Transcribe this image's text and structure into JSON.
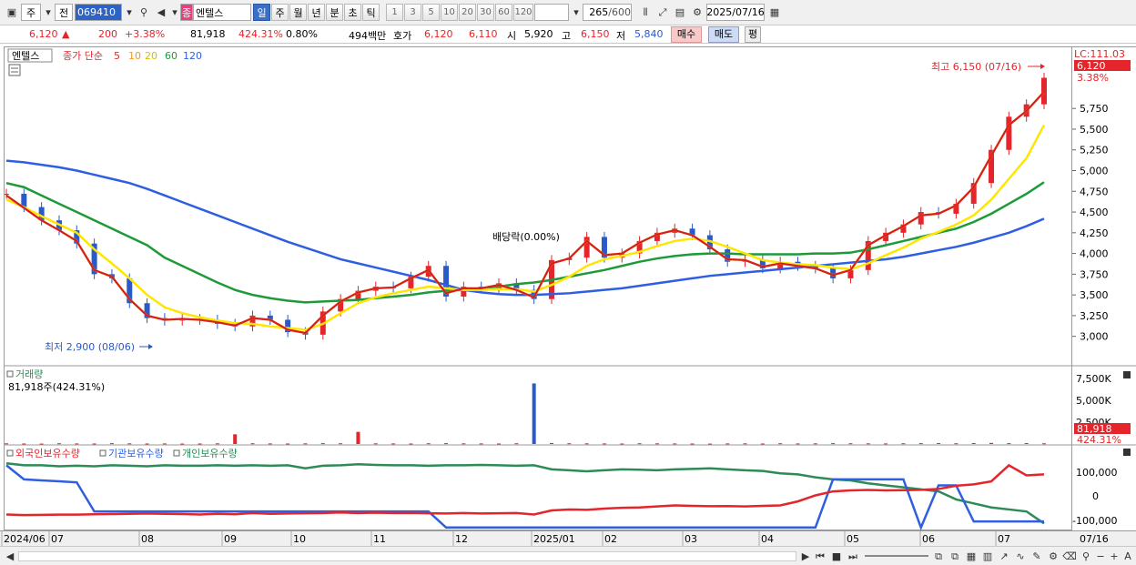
{
  "toolbar": {
    "market": "주",
    "prefix": "전",
    "code": "069410",
    "name_badge": "종",
    "stock_name": "엔텔스",
    "periods": [
      "일",
      "주",
      "월",
      "년",
      "분",
      "초",
      "틱"
    ],
    "selected_period": "일",
    "numbers": [
      "1",
      "3",
      "5",
      "10",
      "20",
      "30",
      "60",
      "120"
    ],
    "count": "265",
    "count_max": "/600",
    "date": "2025/07/16"
  },
  "quote": {
    "price": "6,120",
    "arrow": "▲",
    "change": "200",
    "change_pct": "+3.38%",
    "volume": "81,918",
    "volume_ratio": "424.31%",
    "turnover": "0.80%",
    "amount": "494백만",
    "ask_label": "호가",
    "ask": "6,120",
    "bid": "6,110",
    "open_label": "시",
    "open": "5,920",
    "high_label": "고",
    "high": "6,150",
    "low_label": "저",
    "low": "5,840",
    "buy_button": "매수",
    "sell_button": "매도",
    "eval_button": "평"
  },
  "legend": {
    "name": "엔텔스",
    "ma_label": "종가 단순",
    "ma_periods": [
      "5",
      "10",
      "20",
      "60",
      "120"
    ],
    "ma_colors": [
      "#e4252b",
      "#f29a1e",
      "#ffe600",
      "#1f9a3a",
      "#2f5fe0"
    ]
  },
  "annotations": {
    "high": "최고 6,150 (07/16)",
    "low": "최저 2,900 (08/06)",
    "dividend": "배당락(0.00%)",
    "lc": "LC:111.03",
    "last_price": "6,120",
    "last_pct": "3.38%"
  },
  "volume_panel": {
    "title": "거래량",
    "value": "81,918주(424.31%)",
    "last": "81,918",
    "last_pct": "424.31%",
    "ticks": [
      "7,500K",
      "5,000K",
      "2,500K"
    ]
  },
  "holdings_panel": {
    "series": [
      "외국인보유수량",
      "기관보유수량",
      "개인보유수량"
    ],
    "colors": [
      "#e4252b",
      "#2f5fe0",
      "#2e8b57"
    ],
    "ticks": [
      "100,000",
      "0",
      "-100,000"
    ]
  },
  "price_ticks": [
    "5,750",
    "5,500",
    "5,250",
    "5,000",
    "4,750",
    "4,500",
    "4,250",
    "4,000",
    "3,750",
    "3,500",
    "3,250",
    "3,000"
  ],
  "x_labels": [
    "2024/06",
    "07",
    "08",
    "09",
    "10",
    "11",
    "12",
    "2025/01",
    "02",
    "03",
    "04",
    "05",
    "06",
    "07"
  ],
  "x_last": "07/16",
  "chart_data": {
    "type": "line",
    "title": "",
    "y_range": [
      2700,
      6400
    ],
    "x_range": [
      "2024/06",
      "2025/07/16"
    ],
    "price_close": [
      4720,
      4560,
      4400,
      4280,
      4120,
      3750,
      3700,
      3400,
      3220,
      3190,
      3210,
      3200,
      3150,
      3120,
      3250,
      3200,
      3050,
      3020,
      3300,
      3450,
      3550,
      3600,
      3580,
      3720,
      3850,
      3480,
      3600,
      3580,
      3640,
      3560,
      3450,
      3920,
      3950,
      4200,
      3950,
      4000,
      4150,
      4250,
      4300,
      4220,
      4050,
      3900,
      3920,
      3820,
      3900,
      3850,
      3820,
      3700,
      3800,
      4150,
      4250,
      4350,
      4500,
      4480,
      4600,
      4850,
      5250,
      5650,
      5800,
      6120
    ],
    "sma5": [
      4700,
      4550,
      4400,
      4280,
      4150,
      3800,
      3720,
      3450,
      3250,
      3200,
      3210,
      3200,
      3170,
      3130,
      3220,
      3200,
      3080,
      3040,
      3250,
      3420,
      3530,
      3580,
      3590,
      3700,
      3800,
      3520,
      3580,
      3580,
      3620,
      3560,
      3470,
      3880,
      3940,
      4150,
      3980,
      4000,
      4130,
      4230,
      4280,
      4220,
      4080,
      3930,
      3920,
      3840,
      3880,
      3850,
      3820,
      3740,
      3800,
      4100,
      4220,
      4330,
      4460,
      4480,
      4580,
      4800,
      5180,
      5550,
      5720,
      5950
    ],
    "sma20": [
      4650,
      4560,
      4450,
      4350,
      4250,
      4050,
      3880,
      3700,
      3500,
      3350,
      3280,
      3230,
      3190,
      3160,
      3150,
      3120,
      3100,
      3080,
      3150,
      3280,
      3400,
      3470,
      3520,
      3560,
      3600,
      3580,
      3560,
      3560,
      3570,
      3570,
      3540,
      3620,
      3720,
      3850,
      3930,
      3970,
      4020,
      4090,
      4150,
      4180,
      4150,
      4080,
      4000,
      3920,
      3890,
      3870,
      3860,
      3830,
      3810,
      3880,
      3980,
      4070,
      4180,
      4260,
      4350,
      4460,
      4650,
      4900,
      5150,
      5550
    ],
    "sma60": [
      4850,
      4800,
      4700,
      4600,
      4500,
      4400,
      4300,
      4200,
      4100,
      3950,
      3850,
      3750,
      3650,
      3560,
      3500,
      3460,
      3430,
      3410,
      3420,
      3430,
      3440,
      3460,
      3480,
      3500,
      3530,
      3550,
      3560,
      3580,
      3600,
      3630,
      3650,
      3680,
      3720,
      3760,
      3800,
      3850,
      3900,
      3940,
      3970,
      3990,
      4000,
      4000,
      3990,
      3990,
      3990,
      3990,
      4000,
      4000,
      4010,
      4050,
      4100,
      4150,
      4200,
      4250,
      4300,
      4380,
      4480,
      4600,
      4720,
      4860
    ],
    "sma120": [
      5120,
      5100,
      5070,
      5040,
      5000,
      4950,
      4900,
      4850,
      4780,
      4700,
      4620,
      4540,
      4460,
      4380,
      4300,
      4220,
      4140,
      4070,
      4000,
      3930,
      3880,
      3830,
      3780,
      3730,
      3680,
      3620,
      3560,
      3530,
      3510,
      3500,
      3500,
      3510,
      3520,
      3540,
      3560,
      3580,
      3610,
      3640,
      3670,
      3700,
      3730,
      3750,
      3770,
      3790,
      3810,
      3830,
      3850,
      3870,
      3890,
      3910,
      3930,
      3960,
      4000,
      4040,
      4080,
      4130,
      4190,
      4250,
      4330,
      4420
    ],
    "volume": [
      80,
      60,
      50,
      90,
      70,
      60,
      100,
      80,
      60,
      70,
      50,
      60,
      80,
      1200,
      90,
      70,
      60,
      80,
      100,
      90,
      1500,
      80,
      70,
      60,
      90,
      100,
      80,
      70,
      60,
      90,
      7500,
      120,
      90,
      80,
      70,
      60,
      90,
      80,
      70,
      60,
      50,
      70,
      80,
      60,
      90,
      70,
      80,
      100,
      90,
      80,
      70,
      90,
      100,
      110,
      90,
      120,
      130,
      100,
      110,
      82
    ],
    "foreign": [
      -95000,
      -98000,
      -97000,
      -96000,
      -96000,
      -94000,
      -93000,
      -92000,
      -90000,
      -92000,
      -93000,
      -95000,
      -92000,
      -94000,
      -88000,
      -92000,
      -90000,
      -89000,
      -88000,
      -85000,
      -88000,
      -86000,
      -88000,
      -87000,
      -89000,
      -90000,
      -88000,
      -90000,
      -89000,
      -88000,
      -95000,
      -75000,
      -70000,
      -72000,
      -66000,
      -62000,
      -60000,
      -55000,
      -50000,
      -52000,
      -54000,
      -53000,
      -55000,
      -52000,
      -50000,
      -30000,
      0,
      20000,
      25000,
      27000,
      25000,
      26000,
      28000,
      32000,
      48000,
      55000,
      70000,
      150000,
      100000,
      105000
    ],
    "institution": [
      150000,
      80000,
      75000,
      70000,
      65000,
      -80000,
      -80000,
      -80000,
      -80000,
      -80000,
      -80000,
      -80000,
      -80000,
      -80000,
      -80000,
      -80000,
      -80000,
      -80000,
      -80000,
      -80000,
      -80000,
      -80000,
      -80000,
      -80000,
      -80000,
      -160000,
      -160000,
      -160000,
      -160000,
      -160000,
      -160000,
      -160000,
      -160000,
      -160000,
      -160000,
      -160000,
      -160000,
      -160000,
      -160000,
      -160000,
      -160000,
      -160000,
      -160000,
      -160000,
      -160000,
      -160000,
      -160000,
      80000,
      80000,
      80000,
      80000,
      80000,
      -160000,
      50000,
      50000,
      -130000,
      -130000,
      -130000,
      -130000,
      -130000
    ],
    "individual": [
      160000,
      150000,
      150000,
      145000,
      148000,
      145000,
      150000,
      148000,
      145000,
      150000,
      148000,
      148000,
      150000,
      148000,
      150000,
      148000,
      150000,
      135000,
      148000,
      150000,
      155000,
      152000,
      150000,
      150000,
      148000,
      150000,
      150000,
      152000,
      150000,
      148000,
      150000,
      130000,
      125000,
      120000,
      125000,
      130000,
      128000,
      125000,
      130000,
      132000,
      135000,
      130000,
      125000,
      122000,
      110000,
      105000,
      90000,
      80000,
      75000,
      60000,
      50000,
      40000,
      30000,
      20000,
      -20000,
      -40000,
      -60000,
      -70000,
      -80000,
      -140000
    ]
  }
}
